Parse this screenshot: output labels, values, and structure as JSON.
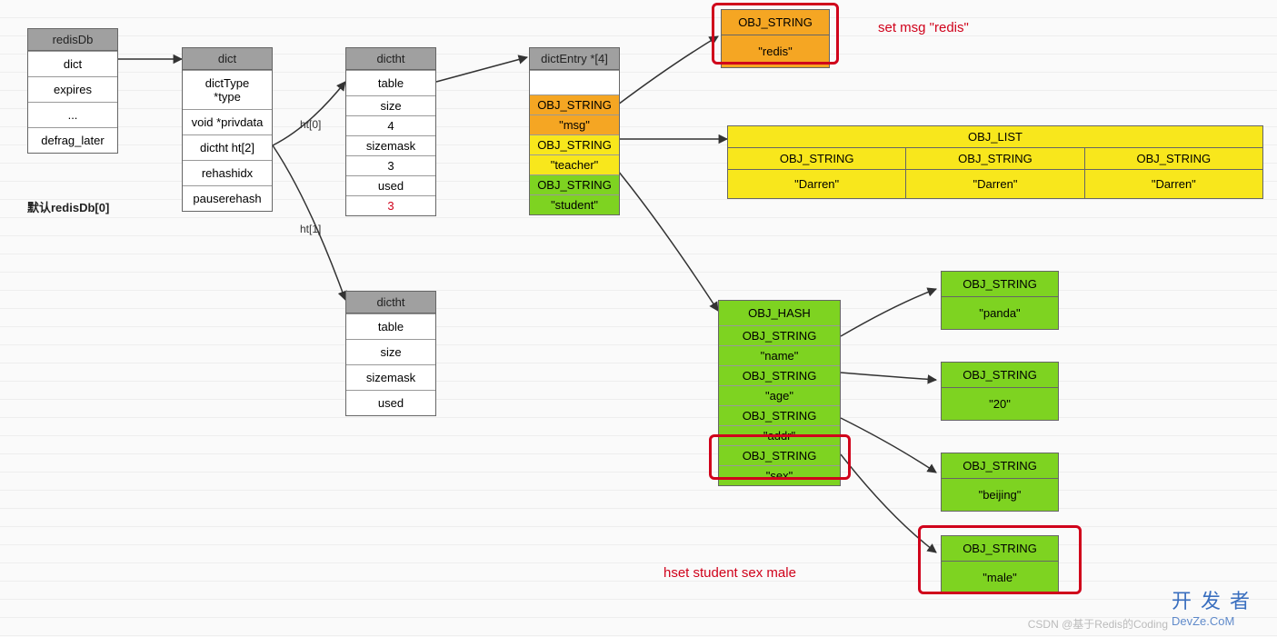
{
  "redisDb": {
    "header": "redisDb",
    "rows": [
      "dict",
      "expires",
      "...",
      "defrag_later"
    ]
  },
  "default_label": "默认redisDb[0]",
  "dict": {
    "header": "dict",
    "rows": [
      "dictType\n*type",
      "void *privdata",
      "dictht ht[2]",
      "rehashidx",
      "pauserehash"
    ]
  },
  "ht_labels": {
    "0": "ht[0]",
    "1": "ht[1]"
  },
  "dictht0": {
    "header": "dictht",
    "rows": [
      {
        "label": "table"
      },
      {
        "label": "size",
        "value": "4"
      },
      {
        "label": "sizemask",
        "value": "3"
      },
      {
        "label": "used",
        "value": "3",
        "value_red": true
      }
    ]
  },
  "dictht1": {
    "header": "dictht",
    "rows": [
      {
        "label": "table"
      },
      {
        "label": "size"
      },
      {
        "label": "sizemask"
      },
      {
        "label": "used"
      }
    ]
  },
  "dictEntry": {
    "header": "dictEntry *[4]",
    "rows": [
      {
        "color": "white",
        "label": ""
      },
      {
        "color": "orange",
        "label": "OBJ_STRING",
        "value": "\"msg\""
      },
      {
        "color": "yellow",
        "label": "OBJ_STRING",
        "value": "\"teacher\""
      },
      {
        "color": "green",
        "label": "OBJ_STRING",
        "value": "\"student\""
      }
    ]
  },
  "obj_redis": {
    "type": "OBJ_STRING",
    "value": "\"redis\""
  },
  "anno_set": "set msg \"redis\"",
  "list": {
    "header": "OBJ_LIST",
    "cols": [
      {
        "type": "OBJ_STRING",
        "value": "\"Darren\""
      },
      {
        "type": "OBJ_STRING",
        "value": "\"Darren\""
      },
      {
        "type": "OBJ_STRING",
        "value": "\"Darren\""
      }
    ]
  },
  "hash": {
    "header": "OBJ_HASH",
    "rows": [
      {
        "label": "OBJ_STRING",
        "value": "\"name\""
      },
      {
        "label": "OBJ_STRING",
        "value": "\"age\""
      },
      {
        "label": "OBJ_STRING",
        "value": "\"addr\""
      },
      {
        "label": "OBJ_STRING",
        "value": "\"sex\""
      }
    ]
  },
  "hash_vals": {
    "name": {
      "type": "OBJ_STRING",
      "value": "\"panda\""
    },
    "age": {
      "type": "OBJ_STRING",
      "value": "\"20\""
    },
    "addr": {
      "type": "OBJ_STRING",
      "value": "\"beijing\""
    },
    "sex": {
      "type": "OBJ_STRING",
      "value": "\"male\""
    }
  },
  "anno_hset": "hset  student sex male",
  "watermark": {
    "dev": "开发者",
    "dev_en": "DevZe.CoM",
    "csdn": "CSDN @基于Redis的Coding"
  }
}
